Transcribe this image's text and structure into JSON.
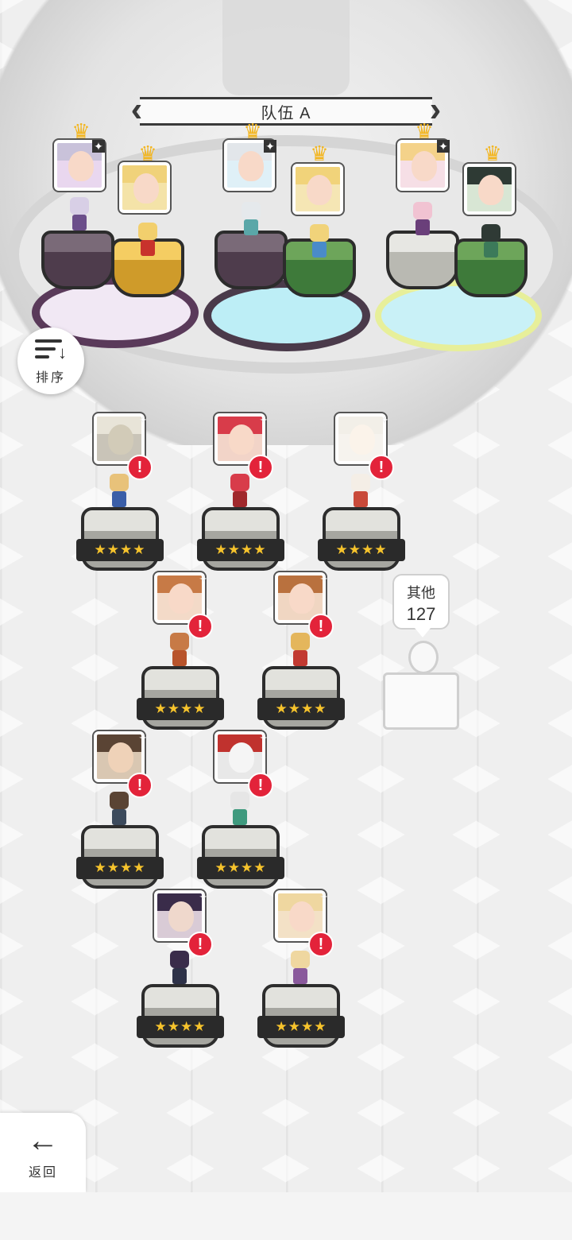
{
  "header": {
    "team_title": "队伍 A",
    "prev_icon": "chevron-left-icon",
    "next_icon": "chevron-right-icon"
  },
  "sort_button": {
    "label": "排序",
    "icon": "sort-icon"
  },
  "team_slots": [
    {
      "slot": 1,
      "hero_a": "silver-hair-girl",
      "hero_b": "blonde-bunny-girl"
    },
    {
      "slot": 2,
      "hero_a": "white-hair-girl",
      "hero_b": "blonde-twin-girl"
    },
    {
      "slot": 3,
      "hero_a": "pink-hair-girl",
      "hero_b": "dark-hair-girl"
    }
  ],
  "roster": {
    "cards": [
      {
        "name": "armored-knight",
        "stars": "★★★★",
        "alert": "!"
      },
      {
        "name": "red-hair-girl",
        "stars": "★★★★",
        "alert": "!"
      },
      {
        "name": "white-creature",
        "stars": "★★★★",
        "alert": "!"
      },
      {
        "name": "brown-hair-girl",
        "stars": "★★★★",
        "alert": "!"
      },
      {
        "name": "tiara-girl",
        "stars": "★★★★",
        "alert": "!"
      },
      {
        "name": "suited-man",
        "stars": "★★★★",
        "alert": "!"
      },
      {
        "name": "masked-figure",
        "stars": "★★★★",
        "alert": "!"
      },
      {
        "name": "purple-hair-woman",
        "stars": "★★★★",
        "alert": "!"
      },
      {
        "name": "horned-girl",
        "stars": "★★★★",
        "alert": "!"
      }
    ],
    "others": {
      "label": "其他",
      "count": "127"
    }
  },
  "footer": {
    "back_label": "返回",
    "back_icon": "arrow-left-icon"
  },
  "colors": {
    "alert": "#e3233a",
    "star": "#f6c32c",
    "crown": "#f3b51d"
  }
}
